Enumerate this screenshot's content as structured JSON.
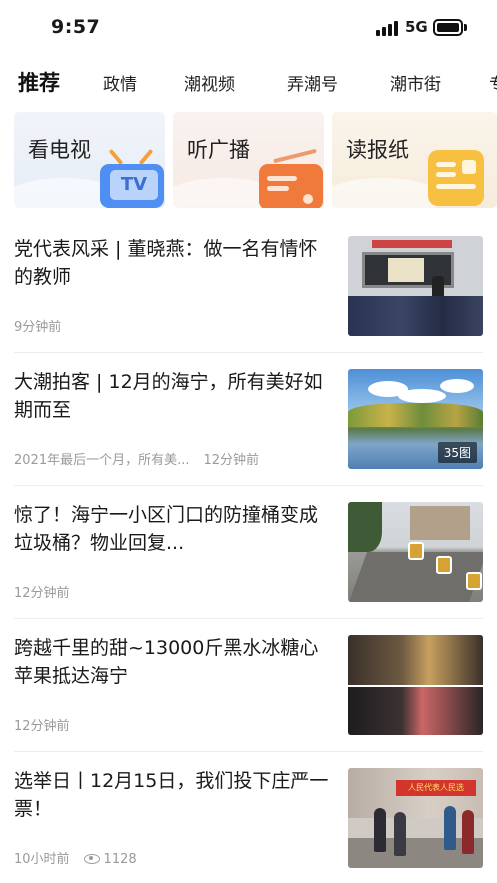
{
  "status_bar": {
    "time": "9:57",
    "network": "5G"
  },
  "tabs": [
    "推荐",
    "政情",
    "潮视频",
    "弄潮号",
    "潮市街",
    "专"
  ],
  "media_cards": [
    {
      "label": "看电视",
      "icon": "tv-icon",
      "icon_text": "TV"
    },
    {
      "label": "听广播",
      "icon": "radio-icon"
    },
    {
      "label": "读报纸",
      "icon": "newspaper-icon"
    }
  ],
  "news": [
    {
      "title": "党代表风采 | 董晓燕：做一名有情怀的教师",
      "summary": "",
      "time": "9分钟前",
      "views": "",
      "badge": ""
    },
    {
      "title": "大潮拍客 | 12月的海宁，所有美好如期而至",
      "summary": "2021年最后一个月，所有美...",
      "time": "12分钟前",
      "views": "",
      "badge": "35图"
    },
    {
      "title": "惊了！海宁一小区门口的防撞桶变成垃圾桶？物业回复...",
      "summary": "",
      "time": "12分钟前",
      "views": "",
      "badge": ""
    },
    {
      "title": "跨越千里的甜~13000斤黑水冰糖心苹果抵达海宁",
      "summary": "",
      "time": "12分钟前",
      "views": "",
      "badge": ""
    },
    {
      "title": "选举日丨12月15日，我们投下庄严一票！",
      "summary": "",
      "time": "10小时前",
      "views": "1128",
      "badge": ""
    }
  ],
  "thumb_sign_text": "人民代表人民选",
  "colors": {
    "tv": "#4f8ef3",
    "radio": "#f07a3c",
    "paper": "#f7c040",
    "meta": "#9a9a9a"
  }
}
